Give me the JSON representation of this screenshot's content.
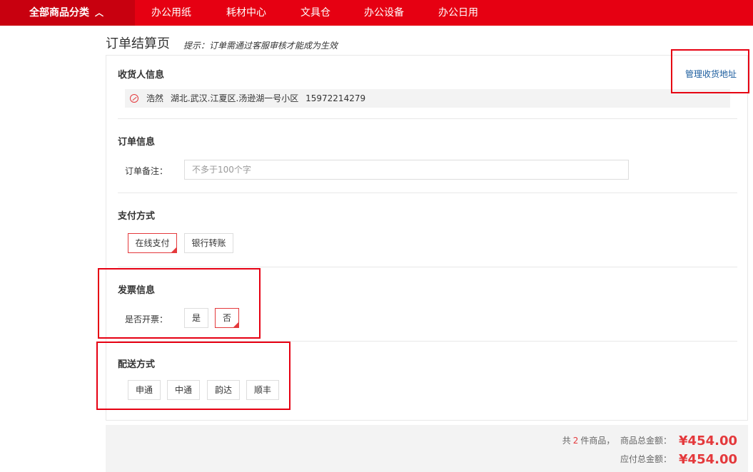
{
  "nav": {
    "category_label": "全部商品分类",
    "items": [
      "办公用纸",
      "耗材中心",
      "文具仓",
      "办公设备",
      "办公日用"
    ]
  },
  "page": {
    "title": "订单结算页",
    "tip": "提示：订单需通过客服审核才能成为生效"
  },
  "consignee": {
    "title": "收货人信息",
    "manage_label": "管理收货地址",
    "name": "浩然",
    "address": "湖北.武汉.江夏区.汤逊湖一号小区",
    "phone": "15972214279"
  },
  "order_info": {
    "title": "订单信息",
    "remark_label": "订单备注：",
    "remark_placeholder": "不多于100个字"
  },
  "payment": {
    "title": "支付方式",
    "options": [
      "在线支付",
      "银行转账"
    ],
    "selected": "在线支付"
  },
  "invoice": {
    "title": "发票信息",
    "question_label": "是否开票：",
    "options": [
      "是",
      "否"
    ],
    "selected": "否"
  },
  "delivery": {
    "title": "配送方式",
    "options": [
      "申通",
      "中通",
      "韵达",
      "顺丰"
    ]
  },
  "summary": {
    "count_prefix": "共",
    "count": "2",
    "count_suffix": "件商品，",
    "goods_total_label": "商品总金额：",
    "goods_total": "¥454.00",
    "payable_label": "应付总金额：",
    "payable_total": "¥454.00"
  },
  "colors": {
    "brand_red": "#e60012",
    "accent_red": "#e4393c",
    "link_blue": "#1a5c9e"
  }
}
